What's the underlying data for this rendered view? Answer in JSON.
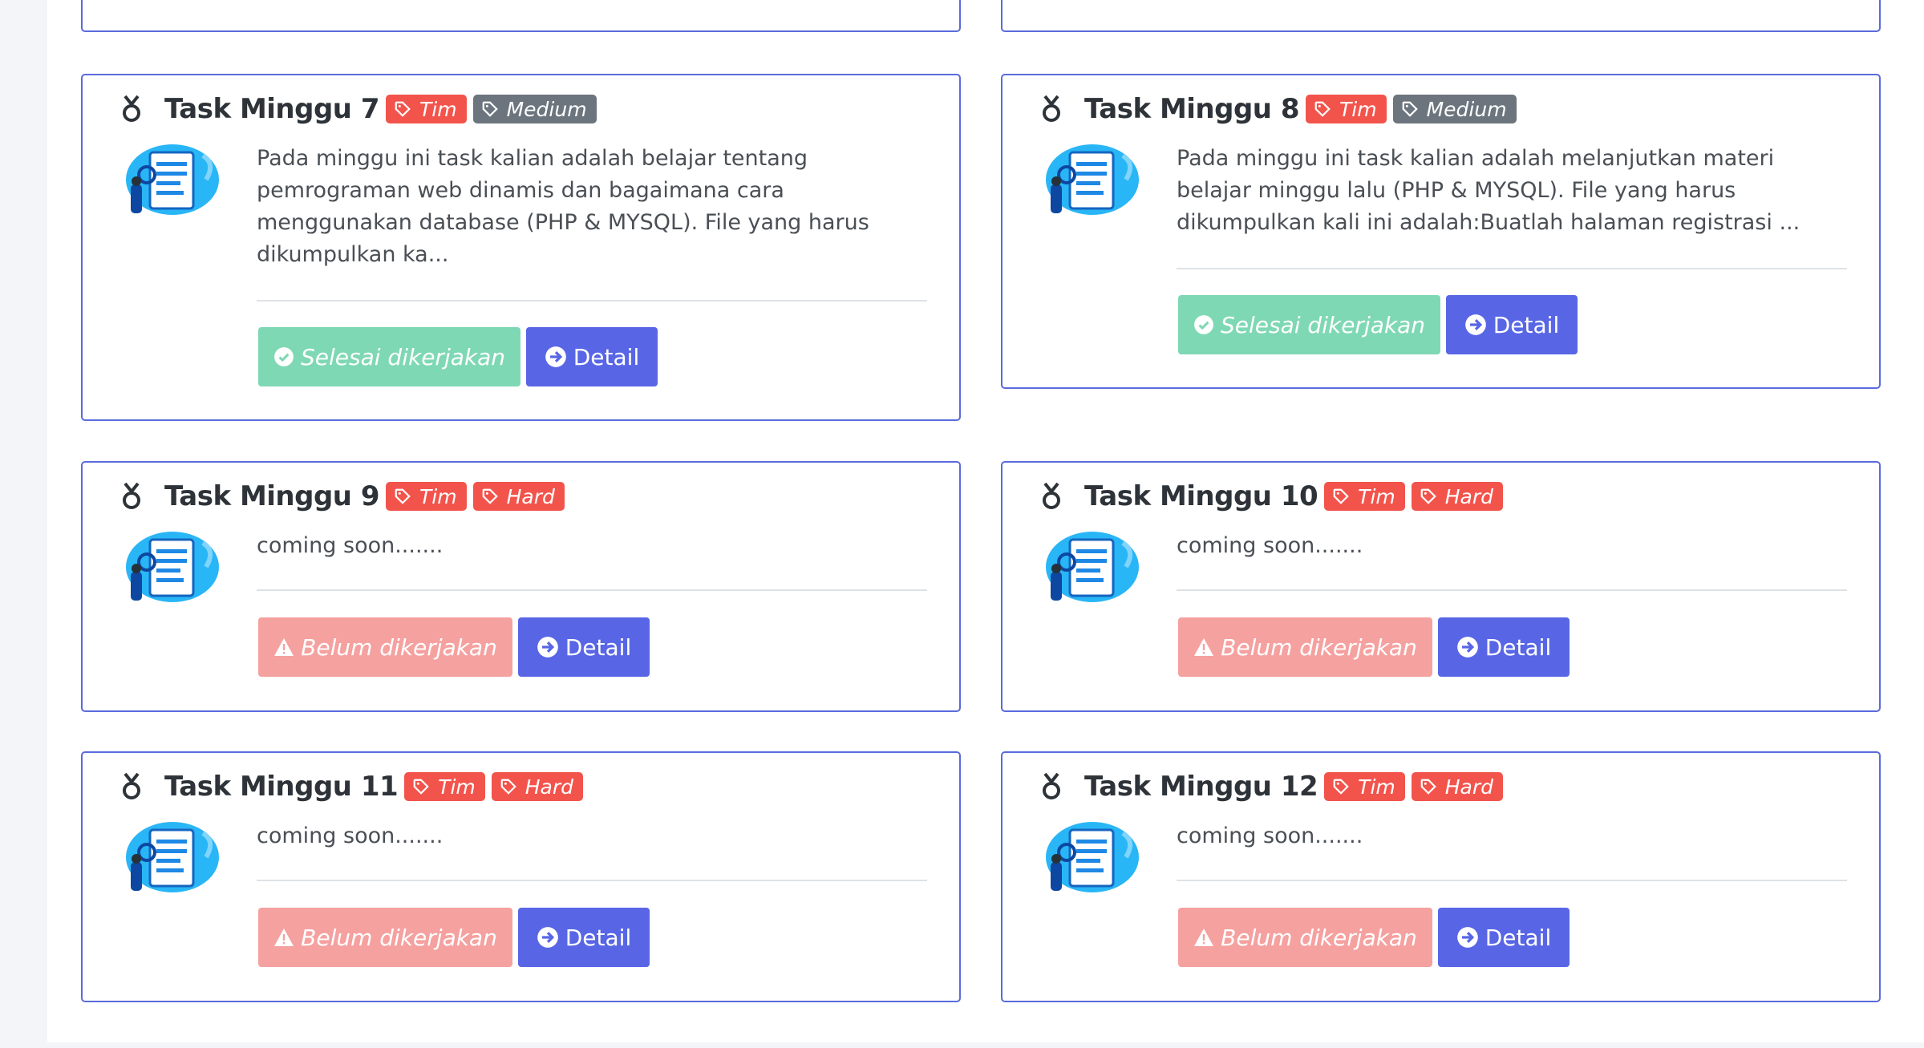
{
  "tasks": [
    {
      "title": "Task Minggu 7",
      "tags": [
        "Tim",
        "Medium"
      ],
      "description": "Pada minggu ini task kalian adalah belajar tentang pemrograman web dinamis dan bagaimana cara menggunakan database (PHP & MYSQL). File yang harus dikumpulkan ka...",
      "status": "Selesai dikerjakan",
      "detail": "Detail"
    },
    {
      "title": "Task Minggu 8",
      "tags": [
        "Tim",
        "Medium"
      ],
      "description": "Pada minggu ini task kalian adalah melanjutkan materi belajar minggu lalu (PHP & MYSQL). File yang harus dikumpulkan kali ini adalah:Buatlah halaman registrasi ...",
      "status": "Selesai dikerjakan",
      "detail": "Detail"
    },
    {
      "title": "Task Minggu 9",
      "tags": [
        "Tim",
        "Hard"
      ],
      "description": "coming soon.......",
      "status": "Belum dikerjakan",
      "detail": "Detail"
    },
    {
      "title": "Task Minggu 10",
      "tags": [
        "Tim",
        "Hard"
      ],
      "description": "coming soon.......",
      "status": "Belum dikerjakan",
      "detail": "Detail"
    },
    {
      "title": "Task Minggu 11",
      "tags": [
        "Tim",
        "Hard"
      ],
      "description": "coming soon.......",
      "status": "Belum dikerjakan",
      "detail": "Detail"
    },
    {
      "title": "Task Minggu 12",
      "tags": [
        "Tim",
        "Hard"
      ],
      "description": "coming soon.......",
      "status": "Belum dikerjakan",
      "detail": "Detail"
    }
  ],
  "colors": {
    "card_border": "#5a6bdc",
    "tag_team": "#f2544c",
    "tag_medium": "#6c757d",
    "tag_hard": "#f2544c",
    "status_done": "#7fd8b4",
    "status_todo": "#f5a1a0",
    "detail_button": "#5866e6"
  }
}
